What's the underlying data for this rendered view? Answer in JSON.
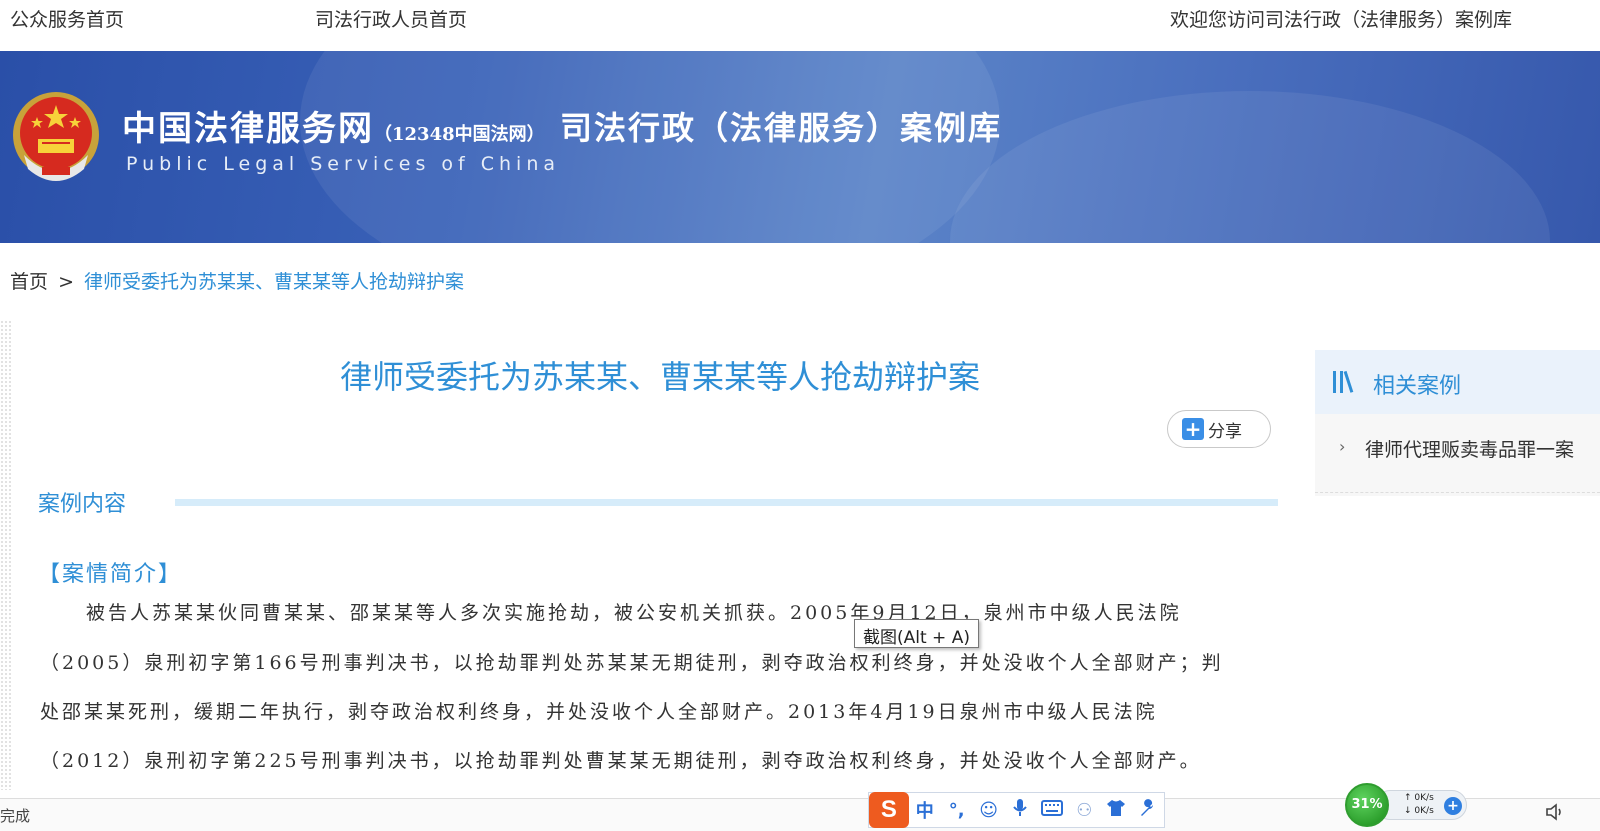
{
  "topnav": {
    "public_home": "公众服务首页",
    "staff_home": "司法行政人员首页",
    "welcome": "欢迎您访问司法行政（法律服务）案例库"
  },
  "banner": {
    "title": "中国法律服务网",
    "title_suffix": "（12348中国法网）",
    "subtitle_en": "Public Legal Services of China",
    "section_title": "司法行政（法律服务）案例库"
  },
  "breadcrumb": {
    "home": "首页",
    "separator": ">",
    "current": "律师受委托为苏某某、曹某某等人抢劫辩护案"
  },
  "article": {
    "title": "律师受委托为苏某某、曹某某等人抢劫辩护案",
    "share_label": "分享",
    "section_heading": "案例内容",
    "subheading": "【案情简介】",
    "paragraph_lines": [
      "被告人苏某某伙同曹某某、邵某某等人多次实施抢劫，被公安机关抓获。2005年9月12日，泉州市中级人民法院",
      "（2005）泉刑初字第166号刑事判决书，以抢劫罪判处苏某某无期徒刑，剥夺政治权利终身，并处没收个人全部财产；判",
      "处邵某某死刑，缓期二年执行，剥夺政治权利终身，并处没收个人全部财产。2013年4月19日泉州市中级人民法院",
      "（2012）泉刑初字第225号刑事判决书，以抢劫罪判处曹某某无期徒刑，剥夺政治权利终身，并处没收个人全部财产。"
    ]
  },
  "sidebar": {
    "title": "相关案例",
    "items": [
      {
        "label": "律师代理贩卖毒品罪一案"
      }
    ]
  },
  "tooltip": {
    "text": "截图(Alt + A)"
  },
  "statusbar": {
    "status": "完成",
    "ime_logo": "S",
    "ime_mode": "中",
    "perf_percent": "31%",
    "net_up": "0K/s",
    "net_down": "0K/s"
  },
  "colors": {
    "accent": "#2f8fd6",
    "banner": "#3a62b8"
  }
}
